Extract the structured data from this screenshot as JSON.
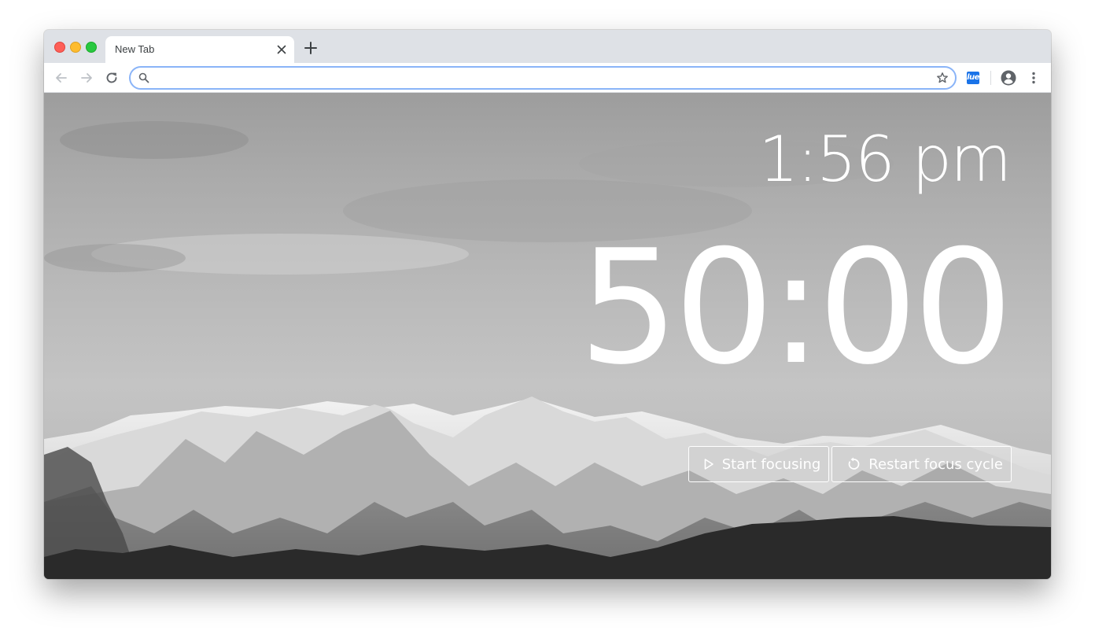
{
  "browser": {
    "tab": {
      "title": "New Tab",
      "close_icon": "close-icon"
    },
    "new_tab_icon": "plus-icon",
    "toolbar": {
      "back_icon": "arrow-left-icon",
      "forward_icon": "arrow-right-icon",
      "reload_icon": "reload-icon",
      "omnibox": {
        "value": "",
        "search_icon": "search-icon",
        "star_icon": "star-icon"
      },
      "extension_label": "lue",
      "profile_icon": "account-circle-icon",
      "menu_icon": "more-vert-icon"
    }
  },
  "page": {
    "clock": "1:56 pm",
    "timer": "50:00",
    "buttons": {
      "start": "Start focusing",
      "restart": "Restart focus cycle"
    }
  },
  "colors": {
    "accent": "#8ab4f8",
    "text_on_image": "#ffffff"
  }
}
